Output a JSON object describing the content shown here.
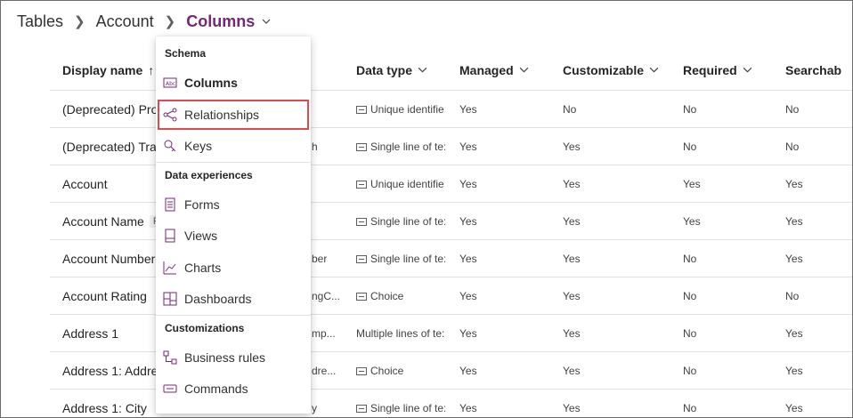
{
  "breadcrumb": {
    "items": [
      "Tables",
      "Account"
    ],
    "current": "Columns"
  },
  "columns": {
    "display_name": "Display name",
    "sort_arrow": "↑",
    "data_type": "Data type",
    "managed": "Managed",
    "customizable": "Customizable",
    "required": "Required",
    "searchable": "Searchab"
  },
  "rows": [
    {
      "name": "(Deprecated) Proc",
      "name_tail": "",
      "dtype": "Unique identifie",
      "dtype_icon": "id-card-icon",
      "managed": "Yes",
      "customizable": "No",
      "required": "No",
      "searchable": "No"
    },
    {
      "name": "(Deprecated) Trav",
      "name_tail": "h",
      "dtype": "Single line of te:",
      "dtype_icon": "text-abc-icon",
      "managed": "Yes",
      "customizable": "Yes",
      "required": "No",
      "searchable": "No"
    },
    {
      "name": "Account",
      "name_tail": "",
      "dtype": "Unique identifie",
      "dtype_icon": "id-card-icon",
      "managed": "Yes",
      "customizable": "Yes",
      "required": "Yes",
      "searchable": "Yes"
    },
    {
      "name": "Account Name",
      "tag": "Pr",
      "name_tail": "",
      "dtype": "Single line of te:",
      "dtype_icon": "text-abc-icon",
      "managed": "Yes",
      "customizable": "Yes",
      "required": "Yes",
      "searchable": "Yes"
    },
    {
      "name": "Account Number",
      "name_tail": "ber",
      "dtype": "Single line of te:",
      "dtype_icon": "text-abc-icon",
      "managed": "Yes",
      "customizable": "Yes",
      "required": "No",
      "searchable": "Yes"
    },
    {
      "name": "Account Rating",
      "name_tail": "ngC...",
      "dtype": "Choice",
      "dtype_icon": "choice-icon",
      "managed": "Yes",
      "customizable": "Yes",
      "required": "No",
      "searchable": "No"
    },
    {
      "name": "Address 1",
      "name_tail": "mp...",
      "dtype": "Multiple lines of te:",
      "dtype_icon": "",
      "managed": "Yes",
      "customizable": "Yes",
      "required": "No",
      "searchable": "Yes"
    },
    {
      "name": "Address 1: Addres",
      "name_tail": "dre...",
      "dtype": "Choice",
      "dtype_icon": "choice-icon",
      "managed": "Yes",
      "customizable": "Yes",
      "required": "No",
      "searchable": "Yes"
    },
    {
      "name": "Address 1: City",
      "name_tail": "y",
      "dtype": "Single line of te:",
      "dtype_icon": "text-abc-icon",
      "managed": "Yes",
      "customizable": "Yes",
      "required": "No",
      "searchable": "Yes"
    }
  ],
  "menu": {
    "sections": [
      {
        "header": "Schema",
        "items": [
          {
            "label": "Columns",
            "icon": "columns-abc-icon",
            "active": true
          },
          {
            "label": "Relationships",
            "icon": "relationships-icon",
            "active": false
          },
          {
            "label": "Keys",
            "icon": "key-icon",
            "active": false
          }
        ]
      },
      {
        "header": "Data experiences",
        "items": [
          {
            "label": "Forms",
            "icon": "form-icon",
            "active": false
          },
          {
            "label": "Views",
            "icon": "view-icon",
            "active": false
          },
          {
            "label": "Charts",
            "icon": "chart-icon",
            "active": false
          },
          {
            "label": "Dashboards",
            "icon": "dashboard-icon",
            "active": false
          }
        ]
      },
      {
        "header": "Customizations",
        "items": [
          {
            "label": "Business rules",
            "icon": "business-rules-icon",
            "active": false
          },
          {
            "label": "Commands",
            "icon": "command-icon",
            "active": false
          }
        ]
      }
    ]
  },
  "colors": {
    "accent": "#742774",
    "highlight_border": "#e04a4f",
    "icon": "#742774"
  }
}
